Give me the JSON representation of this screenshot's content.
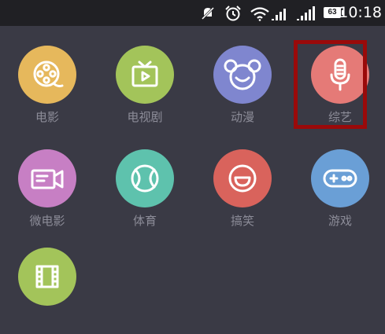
{
  "status_bar": {
    "time": "10:18",
    "battery_level": "63",
    "icons": [
      "mute-icon",
      "alarm-icon",
      "wifi-icon",
      "signal-icon",
      "signal-icon",
      "battery-icon"
    ]
  },
  "categories": [
    {
      "label": "电影",
      "icon": "film-reel-icon",
      "color": "#e6b85c"
    },
    {
      "label": "电视剧",
      "icon": "tv-icon",
      "color": "#a3c45a"
    },
    {
      "label": "动漫",
      "icon": "mickey-face-icon",
      "color": "#7f86cf"
    },
    {
      "label": "综艺",
      "icon": "microphone-icon",
      "color": "#e57a77",
      "highlighted": true
    },
    {
      "label": "微电影",
      "icon": "video-camera-icon",
      "color": "#c77fc4"
    },
    {
      "label": "体育",
      "icon": "ball-icon",
      "color": "#5ec2ad"
    },
    {
      "label": "搞笑",
      "icon": "smile-icon",
      "color": "#d9635c"
    },
    {
      "label": "游戏",
      "icon": "gamepad-icon",
      "color": "#6a9fd6"
    },
    {
      "label": "",
      "icon": "filmstrip-icon",
      "color": "#a3c45a"
    }
  ]
}
